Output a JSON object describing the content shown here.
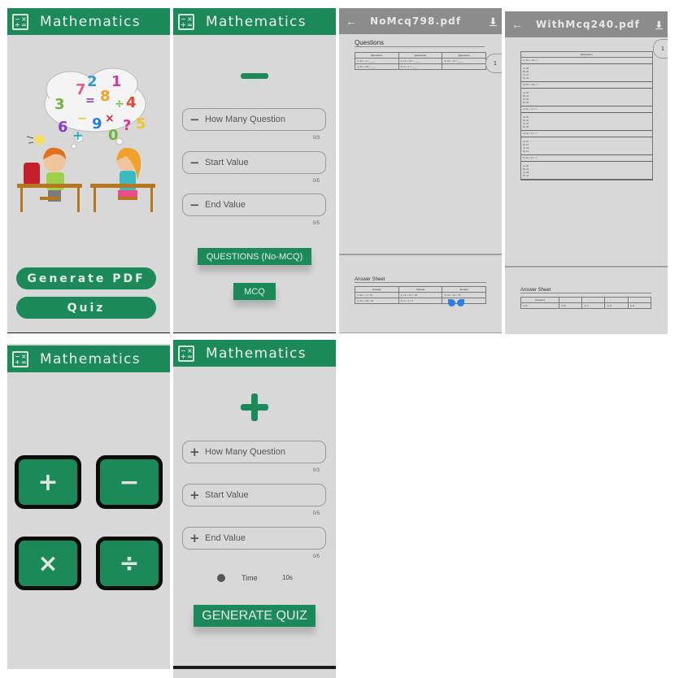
{
  "app": {
    "title": "Mathematics",
    "logo_glyphs": [
      "−",
      "×",
      "+",
      "="
    ]
  },
  "colors": {
    "primary": "#1c8a58",
    "background": "#d8d8d8",
    "pdf_toolbar": "#8c8c8c"
  },
  "home_screen": {
    "illustration": "kids-thinking-math-numbers",
    "buttons": {
      "generate_pdf": "Generate PDF",
      "quiz": "Quiz"
    }
  },
  "pdf_options_screen": {
    "operation_icon": "minus",
    "operation_glyph": "−",
    "fields": [
      {
        "icon": "minus",
        "glyph": "−",
        "placeholder": "How Many Question",
        "counter": "0/3"
      },
      {
        "icon": "minus",
        "glyph": "−",
        "placeholder": "Start Value",
        "counter": "0/5"
      },
      {
        "icon": "minus",
        "glyph": "−",
        "placeholder": "End Value",
        "counter": "0/5"
      }
    ],
    "buttons": {
      "questions_no_mcq": "QUESTIONS (No-MCQ)",
      "mcq": "MCQ"
    }
  },
  "pdf_nomcq_screen": {
    "file_name": "NoMcq798.pdf",
    "back_glyph": "←",
    "download_glyph": "⬇",
    "page_number": "1",
    "questions_title": "Questions",
    "questions_headers": [
      "Questions",
      "Questions",
      "Questions"
    ],
    "questions_rows": [
      [
        "1) 10 + 4 = ____",
        "2) 13 + 15 = ____",
        "3) 15 + 21 = ____"
      ],
      [
        "4) 40 + 28 = ____",
        "5) 3 + 1 = ____",
        ""
      ]
    ],
    "answers_title": "Answer Sheet",
    "answers_headers": [
      "Answer",
      "Answer",
      "Answer"
    ],
    "answers_rows": [
      [
        "1) 10 + 4 = 14",
        "2) 13 + 15 = 28",
        "3) 15 + 21 = 36"
      ],
      [
        "4) 40 + 28 = 68",
        "5) 3 + 1 = 4",
        ""
      ]
    ]
  },
  "pdf_mcq_screen": {
    "file_name": "WithMcq240.pdf",
    "back_glyph": "←",
    "download_glyph": "⬇",
    "page_number": "1",
    "questions_header": "Questions",
    "questions": [
      {
        "q": "1)   10 + 18 = ?",
        "options": [
          "A) 28",
          "B) 20",
          "C) 27",
          "D) 30"
        ]
      },
      {
        "q": "2)   16 + 18 = ?",
        "options": [
          "A) 34",
          "B) 31",
          "C) 30",
          "D) 36"
        ]
      },
      {
        "q": "3)   32 + 6 = ?",
        "options": [
          "A) 38",
          "B) 36",
          "C) 34",
          "D) 40"
        ]
      },
      {
        "q": "4)   10 + 5 = ?",
        "options": [
          "A) 16",
          "B) 15",
          "C) 20",
          "D) 14"
        ]
      },
      {
        "q": "5)   16 + 8 = ?",
        "options": [
          "A) 20",
          "B) 24",
          "C) 26",
          "D) 22"
        ]
      }
    ],
    "answers_title": "Answer Sheet",
    "answers_header": "Answers",
    "answers": [
      "1) B",
      "2) B",
      "3) A",
      "4) B",
      "5) B"
    ]
  },
  "operations_screen": {
    "operations": [
      {
        "name": "addition",
        "glyph": "+"
      },
      {
        "name": "subtraction",
        "glyph": "−"
      },
      {
        "name": "multiplication",
        "glyph": "×"
      },
      {
        "name": "division",
        "glyph": "÷"
      }
    ]
  },
  "quiz_options_screen": {
    "operation_icon": "plus",
    "operation_glyph": "+",
    "fields": [
      {
        "icon": "plus",
        "glyph": "+",
        "placeholder": "How Many Question",
        "counter": "0/3"
      },
      {
        "icon": "plus",
        "glyph": "+",
        "placeholder": "Start Value",
        "counter": "0/5"
      },
      {
        "icon": "plus",
        "glyph": "+",
        "placeholder": "End Value",
        "counter": "0/5"
      }
    ],
    "time_label": "Time",
    "time_value": "10s",
    "buttons": {
      "generate_quiz": "GENERATE QUIZ"
    }
  }
}
